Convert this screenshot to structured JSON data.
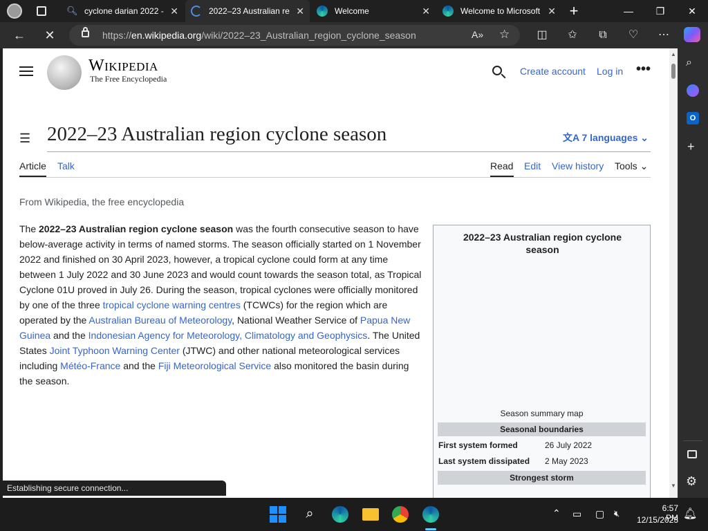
{
  "tabs": [
    {
      "title": "cyclone darian 2022 -",
      "close": "✕"
    },
    {
      "title": "2022–23 Australian re",
      "close": "✕"
    },
    {
      "title": "Welcome",
      "close": "✕"
    },
    {
      "title": "Welcome to Microsoft",
      "close": "✕"
    }
  ],
  "new_tab": "+",
  "window_controls": {
    "minimize": "—",
    "restore": "❐",
    "close": "✕"
  },
  "toolbar": {
    "url_prefix": "https://",
    "url_host": "en.wikipedia.org",
    "url_path": "/wiki/2022–23_Australian_region_cyclone_season"
  },
  "wiki": {
    "logo_title": "Wikipedia",
    "logo_subtitle": "The Free Encyclopedia",
    "create_account": "Create account",
    "log_in": "Log in",
    "page_title": "2022–23 Australian region cyclone season",
    "languages": "7 languages",
    "tabs_left": [
      "Article",
      "Talk"
    ],
    "tabs_right": [
      "Read",
      "Edit",
      "View history",
      "Tools"
    ],
    "from": "From Wikipedia, the free encyclopedia"
  },
  "article": {
    "p1": "The ",
    "bold": "2022–23 Australian region cyclone season",
    "p2": " was the fourth consecutive season to have below-average activity in terms of named storms. The season officially started on 1 November 2022 and finished on 30 April 2023, however, a tropical cyclone could form at any time between 1 July 2022 and 30 June 2023 and would count towards the season total, as Tropical Cyclone 01U proved in July 26. During the season, tropical cyclones were officially monitored by one of the three ",
    "link1": "tropical cyclone warning centres",
    "p3": " (TCWCs) for the region which are operated by the ",
    "link2": "Australian Bureau of Meteorology",
    "p4": ", National Weather Service of ",
    "link3": "Papua New Guinea",
    "p5": " and the ",
    "link4": "Indonesian Agency for Meteorology, Climatology and Geophysics",
    "p6": ". The United States ",
    "link5": "Joint Typhoon Warning Center",
    "p7": " (JTWC) and other national meteorological services including ",
    "link6": "Météo-France",
    "p8": " and the ",
    "link7": "Fiji Meteorological Service",
    "p9": " also monitored the basin during the season."
  },
  "infobox": {
    "title": "2022–23 Australian region cyclone season",
    "caption": "Season summary map",
    "section1": "Seasonal boundaries",
    "first_label": "First system formed",
    "first_value": "26 July 2022",
    "last_label": "Last system dissipated",
    "last_value": "2 May 2023",
    "section2": "Strongest storm"
  },
  "status": "Establishing secure connection...",
  "taskbar": {
    "time": "6:57 PM",
    "date": "12/15/2023"
  },
  "colors": {
    "accent": "#3366cc",
    "browser_bg": "#202020",
    "toolbar_bg": "#2d2d2d"
  }
}
